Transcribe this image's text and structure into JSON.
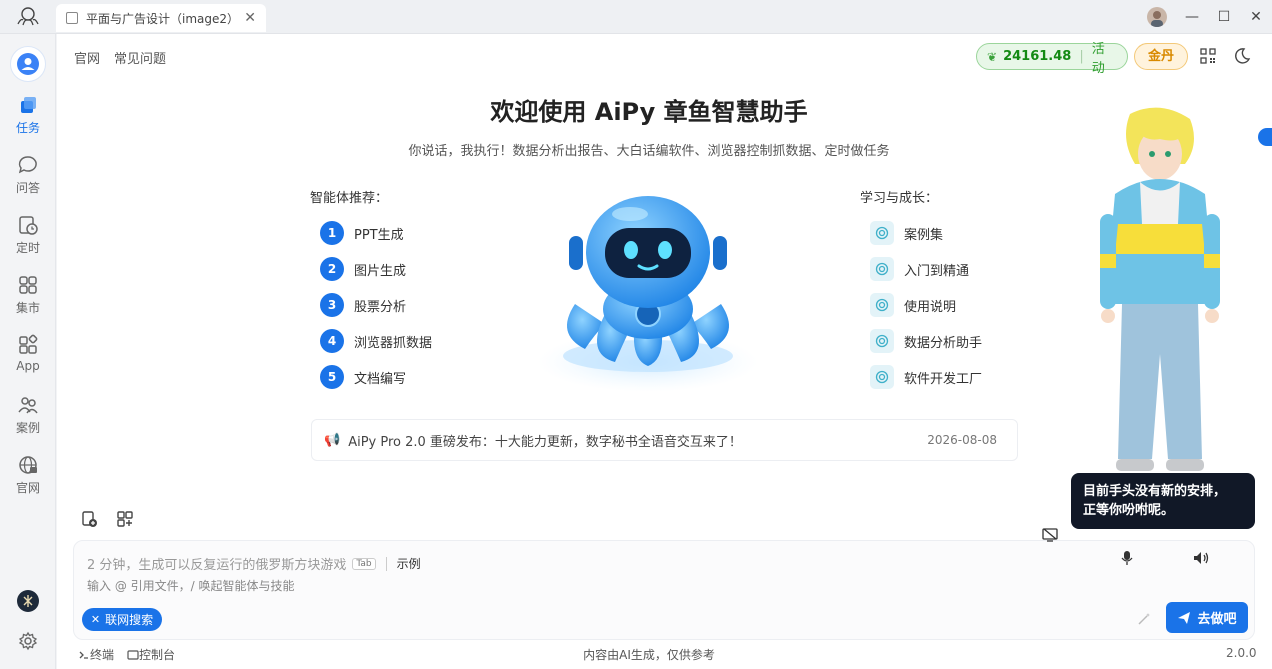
{
  "titlebar": {
    "tab_title": "平面与广告设计（image2）",
    "close_glyph": "✕",
    "minimize_glyph": "—",
    "maximize_glyph": "☐",
    "window_close_glyph": "✕"
  },
  "sidebar": {
    "items": [
      {
        "label": "任务",
        "icon": "cube-stack-icon"
      },
      {
        "label": "问答",
        "icon": "chat-bubble-icon"
      },
      {
        "label": "定时",
        "icon": "clock-doc-icon"
      },
      {
        "label": "集市",
        "icon": "grid-apps-icon"
      },
      {
        "label": "App",
        "icon": "app-blocks-icon"
      },
      {
        "label": "案例",
        "icon": "people-share-icon"
      },
      {
        "label": "官网",
        "icon": "globe-icon"
      }
    ]
  },
  "header": {
    "links": [
      "官网",
      "常见问题"
    ],
    "credits": "24161.48",
    "activity": "活动",
    "gold": "金丹"
  },
  "welcome": {
    "title": "欢迎使用 AiPy 章鱼智慧助手",
    "subtitle": "你说话，我执行！数据分析出报告、大白话编软件、浏览器控制抓数据、定时做任务"
  },
  "agents": {
    "label": "智能体推荐：",
    "items": [
      {
        "num": "1",
        "label": "PPT生成"
      },
      {
        "num": "2",
        "label": "图片生成"
      },
      {
        "num": "3",
        "label": "股票分析"
      },
      {
        "num": "4",
        "label": "浏览器抓数据"
      },
      {
        "num": "5",
        "label": "文档编写"
      }
    ]
  },
  "learning": {
    "label": "学习与成长：",
    "items": [
      "案例集",
      "入门到精通",
      "使用说明",
      "数据分析助手",
      "软件开发工厂"
    ]
  },
  "news": {
    "text": "AiPy Pro 2.0 重磅发布：十大能力更新，数字秘书全语音交互来了！",
    "date": "2026-08-08"
  },
  "input": {
    "placeholder": "2 分钟，生成可以反复运行的俄罗斯方块游戏",
    "tab_key": "Tab",
    "example": "示例",
    "hint": "输入 @ 引用文件，/ 唤起智能体与技能",
    "web_search": "联网搜索",
    "go": "去做吧"
  },
  "footer": {
    "terminal": "终端",
    "console": "控制台",
    "disclaimer": "内容由AI生成，仅供参考",
    "version": "2.0.0"
  },
  "assistant": {
    "bubble_line1": "目前手头没有新的安排，",
    "bubble_line2": "正等你吩咐呢。"
  },
  "colors": {
    "accent": "#1a73e8",
    "credit_green": "#138a13",
    "gold": "#d98a00",
    "bubble_bg": "#111827"
  }
}
